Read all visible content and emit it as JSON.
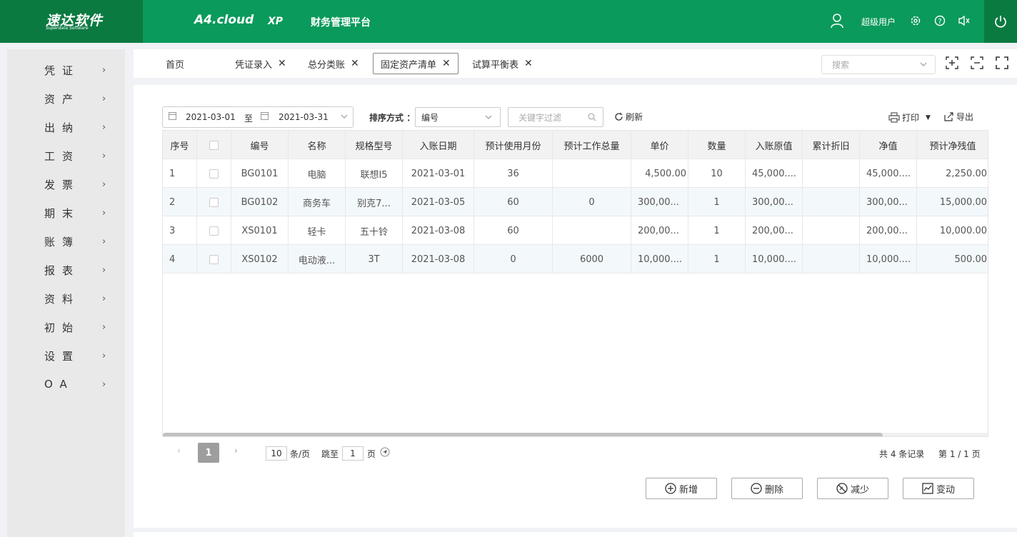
{
  "header": {
    "logo_main": "速达软件",
    "logo_sub": "Superdata Software",
    "brand_a4": "A4.cloud",
    "brand_xp": "XP",
    "brand_platform": "财务管理平台",
    "user_name": "超级用户"
  },
  "sidebar": {
    "items": [
      {
        "label": "凭证"
      },
      {
        "label": "资产"
      },
      {
        "label": "出纳"
      },
      {
        "label": "工资"
      },
      {
        "label": "发票"
      },
      {
        "label": "期末"
      },
      {
        "label": "账簿"
      },
      {
        "label": "报表"
      },
      {
        "label": "资料"
      },
      {
        "label": "初始"
      },
      {
        "label": "设置"
      },
      {
        "label": "OA"
      }
    ]
  },
  "tabs": {
    "home": "首页",
    "items": [
      {
        "label": "凭证录入"
      },
      {
        "label": "总分类账"
      },
      {
        "label": "固定资产清单"
      },
      {
        "label": "试算平衡表"
      }
    ],
    "search_placeholder": "搜索"
  },
  "toolbar": {
    "date_from": "2021-03-01",
    "date_to_label": "至",
    "date_to": "2021-03-31",
    "sort_label": "排序方式 ：",
    "sort_value": "编号",
    "filter_placeholder": "关键字过滤",
    "refresh": "刷新",
    "print": "打印",
    "export": "导出"
  },
  "table": {
    "columns": [
      "序号",
      "",
      "编号",
      "名称",
      "规格型号",
      "入账日期",
      "预计使用月份",
      "预计工作总量",
      "单价",
      "数量",
      "入账原值",
      "累计折旧",
      "净值",
      "预计净残值"
    ],
    "rows": [
      [
        "1",
        "",
        "BG0101",
        "电脑",
        "联想I5",
        "2021-03-01",
        "36",
        "",
        "4,500.00",
        "10",
        "45,000....",
        "",
        "45,000....",
        "2,250.00"
      ],
      [
        "2",
        "",
        "BG0102",
        "商务车",
        "别克7...",
        "2021-03-05",
        "60",
        "0",
        "300,00...",
        "1",
        "300,00...",
        "",
        "300,00...",
        "15,000.00"
      ],
      [
        "3",
        "",
        "XS0101",
        "轻卡",
        "五十铃",
        "2021-03-08",
        "60",
        "",
        "200,00...",
        "1",
        "200,00...",
        "",
        "200,00...",
        "10,000.00"
      ],
      [
        "4",
        "",
        "XS0102",
        "电动液...",
        "3T",
        "2021-03-08",
        "0",
        "6000",
        "10,000....",
        "1",
        "10,000....",
        "",
        "10,000....",
        "500.00"
      ]
    ]
  },
  "pager": {
    "current_page": "1",
    "page_size": "10",
    "per_page_label": "条/页",
    "goto_label": "跳至",
    "goto_value": "1",
    "page_unit": "页",
    "total_records": "共 4 条记录",
    "page_info": "第 1 / 1 页"
  },
  "actions": {
    "add": "新增",
    "delete": "删除",
    "reduce": "减少",
    "change": "变动"
  }
}
